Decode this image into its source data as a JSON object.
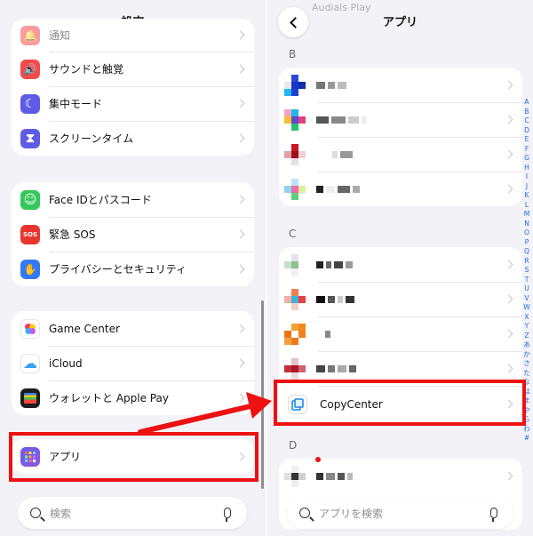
{
  "left": {
    "title": "設定",
    "group1": [
      {
        "label": "通知",
        "icon": "bell-icon",
        "color": "#f44b4b",
        "glyph": "🔔"
      },
      {
        "label": "サウンドと触覚",
        "icon": "speaker-icon",
        "color": "#f44b4b",
        "glyph": "🔊"
      },
      {
        "label": "集中モード",
        "icon": "moon-icon",
        "color": "#5e5ce6",
        "glyph": "☾"
      },
      {
        "label": "スクリーンタイム",
        "icon": "hourglass-icon",
        "color": "#5e5ce6",
        "glyph": "⧗"
      }
    ],
    "group2": [
      {
        "label": "Face IDとパスコード",
        "icon": "face-id-icon",
        "color": "#34c759",
        "glyph": "☺"
      },
      {
        "label": "緊急 SOS",
        "icon": "sos-icon",
        "color": "#e8362f",
        "glyph": "SOS"
      },
      {
        "label": "プライバシーとセキュリティ",
        "icon": "hand-icon",
        "color": "#3478f6",
        "glyph": "✋"
      }
    ],
    "group3": [
      {
        "label": "Game Center",
        "icon": "game-center-icon",
        "color": "#ffffff",
        "glyph": "●"
      },
      {
        "label": "iCloud",
        "icon": "icloud-icon",
        "color": "#ffffff",
        "glyph": "☁"
      },
      {
        "label": "ウォレットと Apple Pay",
        "icon": "wallet-icon",
        "color": "#1c1c1e",
        "glyph": "▤"
      }
    ],
    "apps_row": {
      "label": "アプリ",
      "icon": "apps-grid-icon",
      "color": "#6b5ce7",
      "glyph": "▦"
    },
    "search_placeholder": "検索"
  },
  "right": {
    "title": "アプリ",
    "faded_app_name": "Audials Play",
    "section_b": "B",
    "section_c": "C",
    "section_d": "D",
    "copycenter_label": "CopyCenter",
    "search_placeholder": "アプリを検索",
    "index_letters": [
      "A",
      "B",
      "C",
      "D",
      "E",
      "F",
      "G",
      "H",
      "I",
      "J",
      "K",
      "L",
      "M",
      "N",
      "O",
      "P",
      "Q",
      "R",
      "S",
      "T",
      "U",
      "V",
      "W",
      "X",
      "Y",
      "Z",
      "あ",
      "か",
      "さ",
      "た",
      "な",
      "は",
      "ま",
      "や",
      "ら",
      "わ",
      "#"
    ]
  },
  "colors": {
    "highlight_red": "#ee1111",
    "index_blue": "#1e6fe6"
  }
}
